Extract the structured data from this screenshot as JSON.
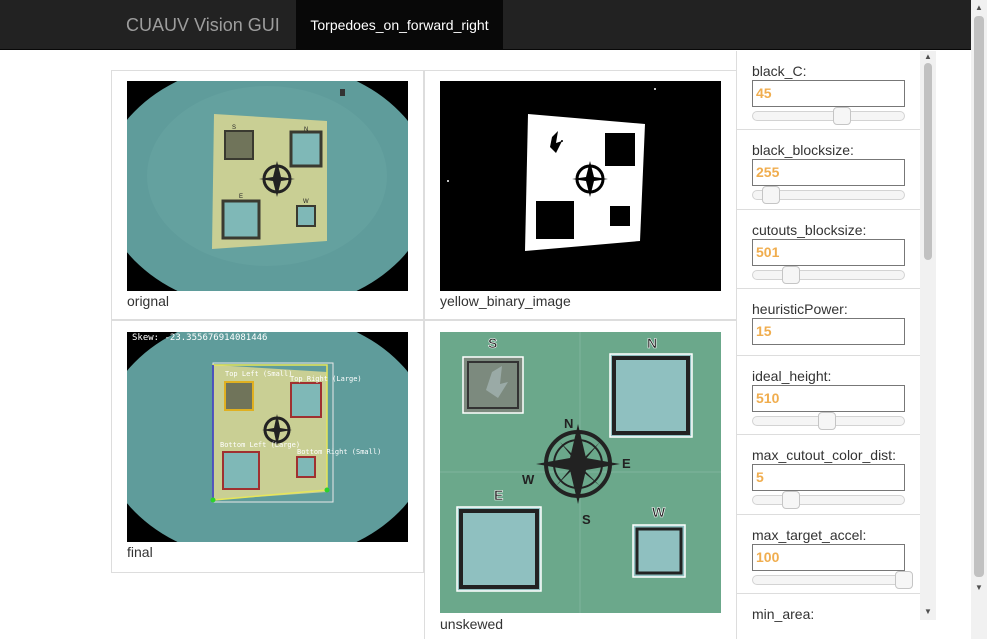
{
  "navbar": {
    "brand": "CUAUV Vision GUI",
    "active_tab": "Torpedoes_on_forward_right"
  },
  "images": [
    {
      "caption": "orignal"
    },
    {
      "caption": "yellow_binary_image"
    },
    {
      "caption": "final"
    },
    {
      "caption": "unskewed"
    }
  ],
  "overlay": {
    "skew": "Skew: -23.355676914081446",
    "top_left": "Top Left (Small)",
    "top_right": "Top Right (Large)",
    "bottom_left": "Bottom Left (Large)",
    "bottom_right": "Bottom Right (Small)"
  },
  "board_letters": {
    "s": "S",
    "n": "N",
    "e": "E",
    "w": "W"
  },
  "params": [
    {
      "label": "black_C:",
      "value": "45",
      "slider_fraction": 0.59
    },
    {
      "label": "black_blocksize:",
      "value": "255",
      "slider_fraction": 0.12
    },
    {
      "label": "cutouts_blocksize:",
      "value": "501",
      "slider_fraction": 0.25
    },
    {
      "label": "heuristicPower:",
      "value": "15",
      "slider_fraction": null
    },
    {
      "label": "ideal_height:",
      "value": "510",
      "slider_fraction": 0.49
    },
    {
      "label": "max_cutout_color_dist:",
      "value": "5",
      "slider_fraction": 0.25
    },
    {
      "label": "max_target_accel:",
      "value": "100",
      "slider_fraction": 1.0
    },
    {
      "label": "min_area:",
      "value": "",
      "slider_fraction": null
    }
  ],
  "colors": {
    "navbar_bg": "#222222",
    "param_value": "#f0ad4e",
    "water": "#5f9c9b"
  }
}
